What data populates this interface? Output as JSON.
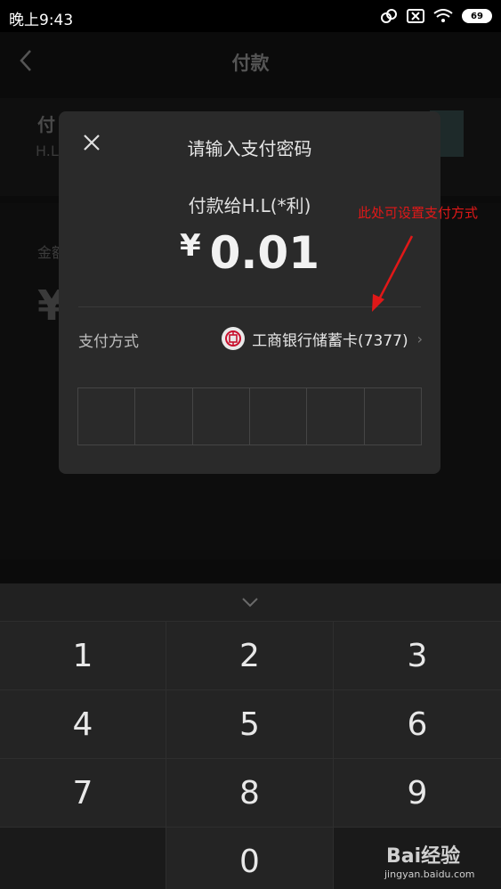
{
  "status_bar": {
    "time": "晚上9:43",
    "battery": "69"
  },
  "header": {
    "title": "付款"
  },
  "background": {
    "payee_label": "付",
    "payee_sub": "H.L",
    "amount_label": "金额",
    "amount_symbol": "¥"
  },
  "dialog": {
    "title": "请输入支付密码",
    "payee": "付款给H.L(*利)",
    "currency": "¥",
    "amount": "0.01",
    "payment_method_label": "支付方式",
    "payment_method_value": "工商银行储蓄卡(7377)",
    "password_cells": 6
  },
  "annotation": {
    "text": "此处可设置支付方式",
    "color": "#e01818"
  },
  "keypad": {
    "keys": [
      "1",
      "2",
      "3",
      "4",
      "5",
      "6",
      "7",
      "8",
      "9",
      "",
      "0",
      ""
    ]
  },
  "watermark": {
    "text": "Bai经验",
    "url": "jingyan.baidu.com"
  }
}
